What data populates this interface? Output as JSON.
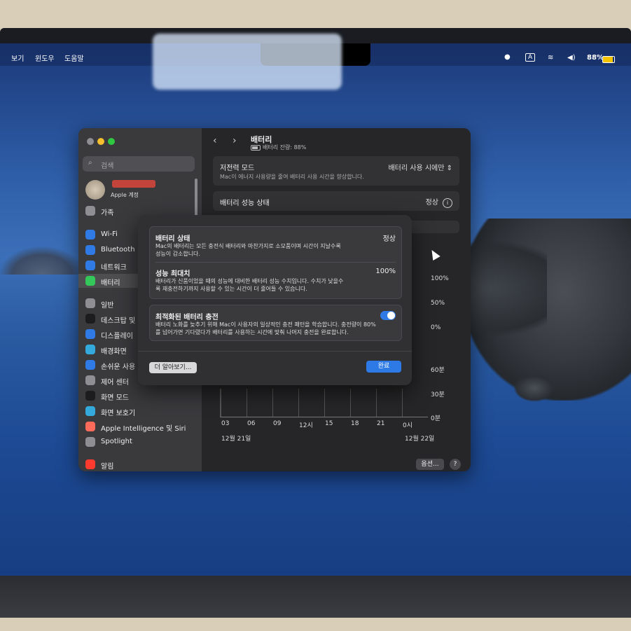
{
  "menubar": {
    "items": [
      "보기",
      "윈도우",
      "도움말"
    ],
    "battery_percent": "88%"
  },
  "settings": {
    "search_placeholder": "검색",
    "account_label": "Apple 계정",
    "sidebar": [
      {
        "label": "가족",
        "icon": "family-icon",
        "color": "#8e8e93"
      },
      {
        "label": "Wi-Fi",
        "icon": "wifi-icon",
        "color": "#2f7ae5"
      },
      {
        "label": "Bluetooth",
        "icon": "bluetooth-icon",
        "color": "#2f7ae5"
      },
      {
        "label": "네트워크",
        "icon": "network-icon",
        "color": "#2f7ae5"
      },
      {
        "label": "배터리",
        "icon": "battery-icon",
        "color": "#34c759",
        "selected": true
      },
      {
        "label": "일반",
        "icon": "gear-icon",
        "color": "#8e8e93"
      },
      {
        "label": "데스크탑 및 Dock",
        "icon": "dock-icon",
        "color": "#1c1c1e"
      },
      {
        "label": "디스플레이",
        "icon": "display-icon",
        "color": "#2f7ae5"
      },
      {
        "label": "배경화면",
        "icon": "wallpaper-icon",
        "color": "#34aadc"
      },
      {
        "label": "손쉬운 사용",
        "icon": "accessibility-icon",
        "color": "#2f7ae5"
      },
      {
        "label": "제어 센터",
        "icon": "control-center-icon",
        "color": "#8e8e93"
      },
      {
        "label": "화면 모드",
        "icon": "appearance-icon",
        "color": "#1c1c1e"
      },
      {
        "label": "화면 보호기",
        "icon": "screensaver-icon",
        "color": "#34aadc"
      },
      {
        "label": "Apple Intelligence 및 Siri",
        "icon": "siri-icon",
        "color": "#ff6b5b"
      },
      {
        "label": "Spotlight",
        "icon": "spotlight-icon",
        "color": "#8e8e93"
      },
      {
        "label": "알림",
        "icon": "bell-icon",
        "color": "#ff3b30"
      }
    ],
    "main": {
      "title": "배터리",
      "subtitle": "배터리 잔량: 88%",
      "low_power_label": "저전력 모드",
      "low_power_desc": "Mac이 에너지 사용량을 줄여 배터리 사용 시간을 향상합니다.",
      "low_power_value": "배터리 사용 시에만",
      "health_label": "배터리 성능 상태",
      "health_value": "정상",
      "chart_axis_right": [
        "100%",
        "50%",
        "0%",
        "60분",
        "30분",
        "0분"
      ],
      "chart_axis_bottom": [
        "03",
        "06",
        "09",
        "12시",
        "15",
        "18",
        "21",
        "0시"
      ],
      "date_left": "12월 21일",
      "date_right": "12월 22일",
      "options_button": "옵션...",
      "help_button": "?"
    }
  },
  "sheet": {
    "battery_state_title": "배터리 상태",
    "battery_state_value": "정상",
    "battery_state_desc": "Mac의 배터리는 모든 충전식 배터리와 마찬가지로 소모품이며 시간이 지날수록 성능이 감소합니다.",
    "max_capacity_title": "성능 최대치",
    "max_capacity_value": "100%",
    "max_capacity_desc": "배터리가 신품이었을 때의 성능에 대비한 배터리 성능 수치입니다. 수치가 낮을수록 재충전하기까지 사용할 수 있는 시간이 더 줄어들 수 있습니다.",
    "optimized_title": "최적화된 배터리 충전",
    "optimized_desc": "배터리 노화를 늦추기 위해 Mac이 사용자의 일상적인 충전 패턴을 학습합니다. 충전량이 80%를 넘어가면 기다렸다가 배터리를 사용하는 시간에 맞춰 나머지 충전을 완료합니다.",
    "optimized_enabled": true,
    "learn_more_button": "더 알아보기...",
    "done_button": "완료"
  }
}
